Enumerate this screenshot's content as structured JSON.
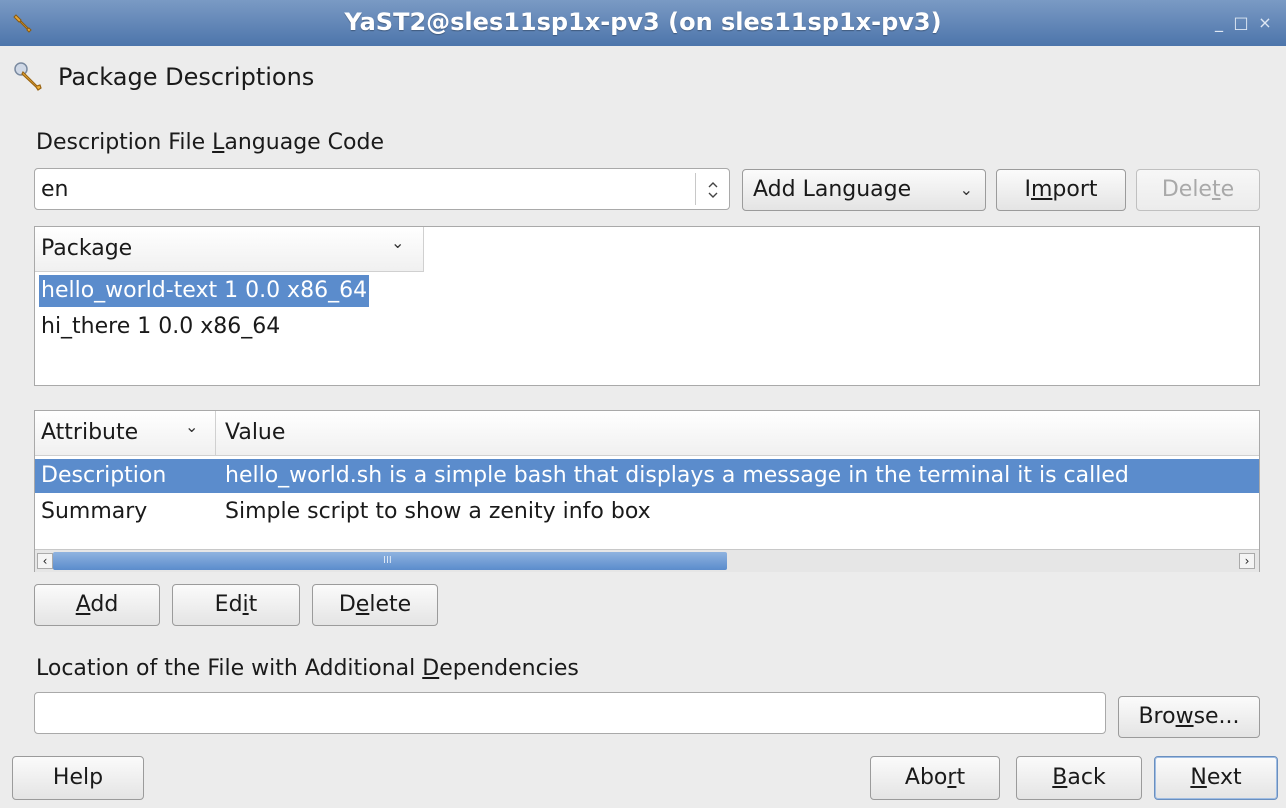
{
  "window": {
    "title": "YaST2@sles11sp1x-pv3 (on sles11sp1x-pv3)",
    "minimize": "_",
    "maximize": "□",
    "close": "×"
  },
  "page": {
    "title": "Package Descriptions",
    "icon": "wrench-icon"
  },
  "language": {
    "label_pre": "Description File ",
    "label_u": "L",
    "label_post": "anguage Code",
    "value": "en",
    "add_language": "Add Language",
    "import_pre": "I",
    "import_u": "m",
    "import_post": "port",
    "delete_pre": "Dele",
    "delete_u": "t",
    "delete_post": "e"
  },
  "packages": {
    "column": "Package",
    "rows": [
      "hello_world-text 1 0.0 x86_64",
      "hi_there 1 0.0 x86_64"
    ],
    "selected_index": 0
  },
  "attributes": {
    "columns": [
      "Attribute",
      "Value"
    ],
    "rows": [
      {
        "attribute": "Description",
        "value": "hello_world.sh is a simple bash that displays a message in the terminal it is called"
      },
      {
        "attribute": "Summary",
        "value": "Simple script to show a zenity info box"
      }
    ],
    "selected_index": 0,
    "scroll_mark": "III"
  },
  "row_buttons": {
    "add_u": "A",
    "add_post": "dd",
    "edit_pre": "Ed",
    "edit_u": "i",
    "edit_post": "t",
    "delete_pre": "D",
    "delete_u": "e",
    "delete_post": "lete"
  },
  "dependencies": {
    "label_pre": "Location of the File with Additional ",
    "label_u": "D",
    "label_post": "ependencies",
    "value": "",
    "browse_pre": "Bro",
    "browse_u": "w",
    "browse_post": "se..."
  },
  "footer": {
    "help": "Help",
    "abort_pre": "Abo",
    "abort_u": "r",
    "abort_post": "t",
    "back_u": "B",
    "back_post": "ack",
    "next_u": "N",
    "next_post": "ext"
  }
}
